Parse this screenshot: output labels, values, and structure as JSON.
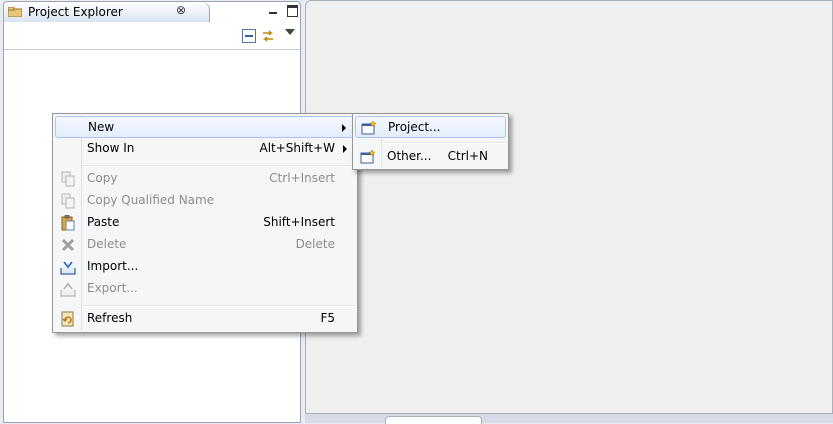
{
  "explorer": {
    "title": "Project Explorer",
    "close_glyph": "⊗"
  },
  "context_menu": {
    "new": {
      "label": "New"
    },
    "show_in": {
      "label": "Show In",
      "shortcut": "Alt+Shift+W"
    },
    "copy": {
      "label": "Copy",
      "shortcut": "Ctrl+Insert"
    },
    "copy_qualified_name": {
      "label": "Copy Qualified Name"
    },
    "paste": {
      "label": "Paste",
      "shortcut": "Shift+Insert"
    },
    "delete": {
      "label": "Delete",
      "shortcut": "Delete"
    },
    "import": {
      "label": "Import..."
    },
    "export": {
      "label": "Export..."
    },
    "refresh": {
      "label": "Refresh",
      "shortcut": "F5"
    }
  },
  "submenu": {
    "project": {
      "label": "Project..."
    },
    "other": {
      "label": "Other...",
      "shortcut": "Ctrl+N"
    }
  },
  "icons": {
    "new-project-icon": "wizard",
    "copy-icon": "copy",
    "paste-icon": "paste",
    "delete-icon": "x",
    "import-icon": "import",
    "export-icon": "export",
    "refresh-icon": "refresh"
  },
  "colors": {
    "highlight_border": "#a8c7f0",
    "disabled_text": "#8d8d8d"
  }
}
